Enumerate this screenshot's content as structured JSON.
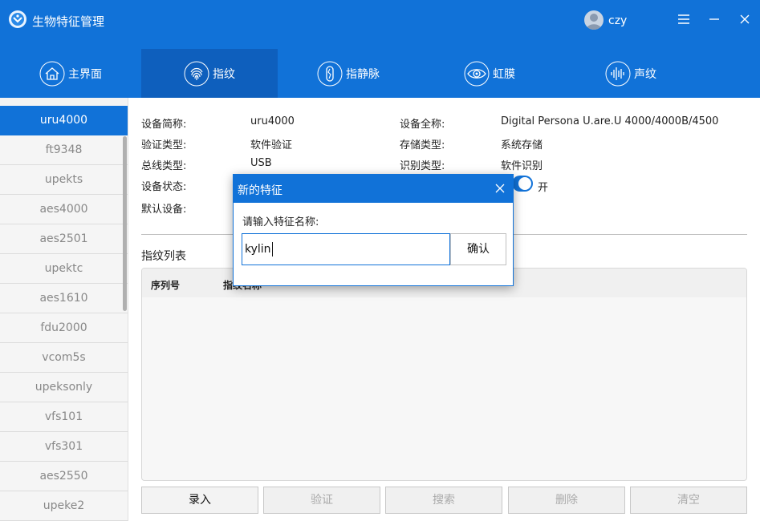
{
  "app": {
    "title": "生物特征管理",
    "user": "czy"
  },
  "window_controls": {
    "menu_icon": "menu-icon",
    "minimize_icon": "minimize-icon",
    "close_icon": "close-icon"
  },
  "tabs": [
    {
      "label": "主界面",
      "icon": "home-icon",
      "active": false
    },
    {
      "label": "指纹",
      "icon": "fingerprint-icon",
      "active": true
    },
    {
      "label": "指静脉",
      "icon": "finger-vein-icon",
      "active": false
    },
    {
      "label": "虹膜",
      "icon": "eye-icon",
      "active": false
    },
    {
      "label": "声纹",
      "icon": "voice-icon",
      "active": false
    }
  ],
  "devices": [
    "uru4000",
    "ft9348",
    "upekts",
    "aes4000",
    "aes2501",
    "upektc",
    "aes1610",
    "fdu2000",
    "vcom5s",
    "upeksonly",
    "vfs101",
    "vfs301",
    "aes2550",
    "upeke2"
  ],
  "device_info": {
    "short_name_label": "设备简称:",
    "short_name": "uru4000",
    "full_name_label": "设备全称:",
    "full_name": "Digital Persona U.are.U 4000/4000B/4500",
    "verify_type_label": "验证类型:",
    "verify_type": "软件验证",
    "storage_type_label": "存储类型:",
    "storage_type": "系统存储",
    "bus_type_label": "总线类型:",
    "bus_type": "USB",
    "identify_type_label": "识别类型:",
    "identify_type": "软件识别",
    "status_label": "设备状态:",
    "toggle_label": "开",
    "default_device_label": "默认设备:"
  },
  "fingerprint_list": {
    "title": "指纹列表",
    "columns": [
      "序列号",
      "指纹名称"
    ]
  },
  "actions": [
    {
      "label": "录入",
      "enabled": true
    },
    {
      "label": "验证",
      "enabled": false
    },
    {
      "label": "搜索",
      "enabled": false
    },
    {
      "label": "删除",
      "enabled": false
    },
    {
      "label": "清空",
      "enabled": false
    }
  ],
  "dialog": {
    "title": "新的特征",
    "prompt": "请输入特征名称:",
    "input_value": "kylin",
    "confirm_label": "确认"
  },
  "colors": {
    "primary": "#1172d8",
    "active_tab": "#0e5fbd"
  }
}
